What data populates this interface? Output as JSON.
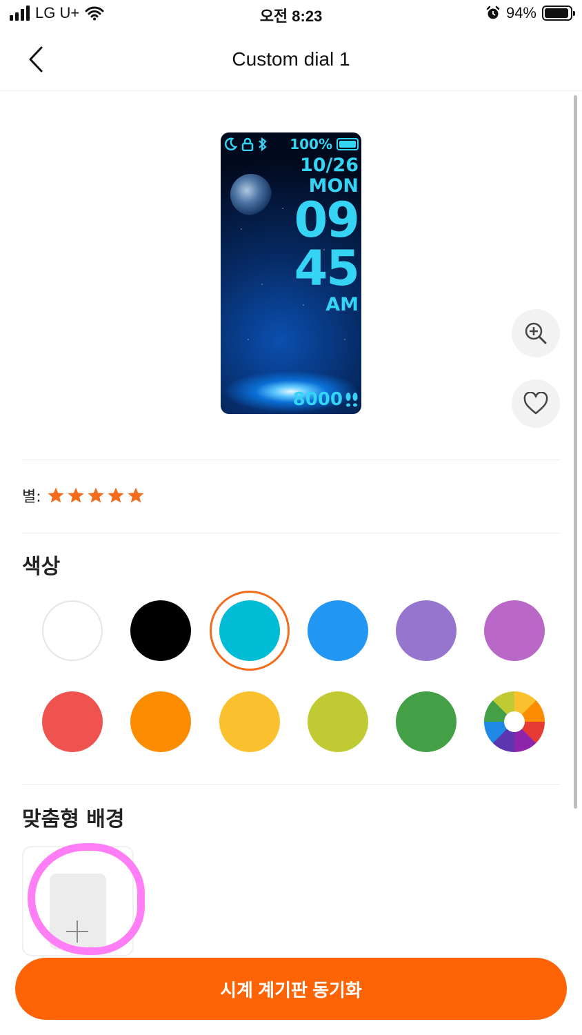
{
  "status_bar": {
    "carrier": "LG U+",
    "time": "오전 8:23",
    "battery_percent": "94%",
    "battery_level": 0.94
  },
  "nav": {
    "title": "Custom dial 1",
    "back_icon": "chevron-left-icon"
  },
  "watch_preview": {
    "battery": "100%",
    "date": "10/26",
    "day": "MON",
    "hour": "09",
    "minute": "45",
    "ampm": "AM",
    "steps": "8000",
    "text_color": "#35d4f5"
  },
  "side_actions": {
    "zoom_icon": "zoom-in-icon",
    "favorite_icon": "heart-icon"
  },
  "rating": {
    "label": "별:",
    "stars": 5,
    "star_color": "#f26c1c"
  },
  "color_section": {
    "title": "색상",
    "selected_index": 2,
    "selected_ring_color": "#f26c1c",
    "colors": [
      "#ffffff",
      "#000000",
      "#00bcd4",
      "#2196f3",
      "#9575cd",
      "#ba68c8",
      "#ef5350",
      "#fb8c00",
      "#fbc02d",
      "#c0ca33",
      "#43a047",
      "multicolor-wheel"
    ]
  },
  "custom_background": {
    "title": "맞춤형 배경",
    "add_icon": "plus-icon"
  },
  "sync_button": {
    "label": "시계 계기판 동기화",
    "color": "#fe6406"
  }
}
